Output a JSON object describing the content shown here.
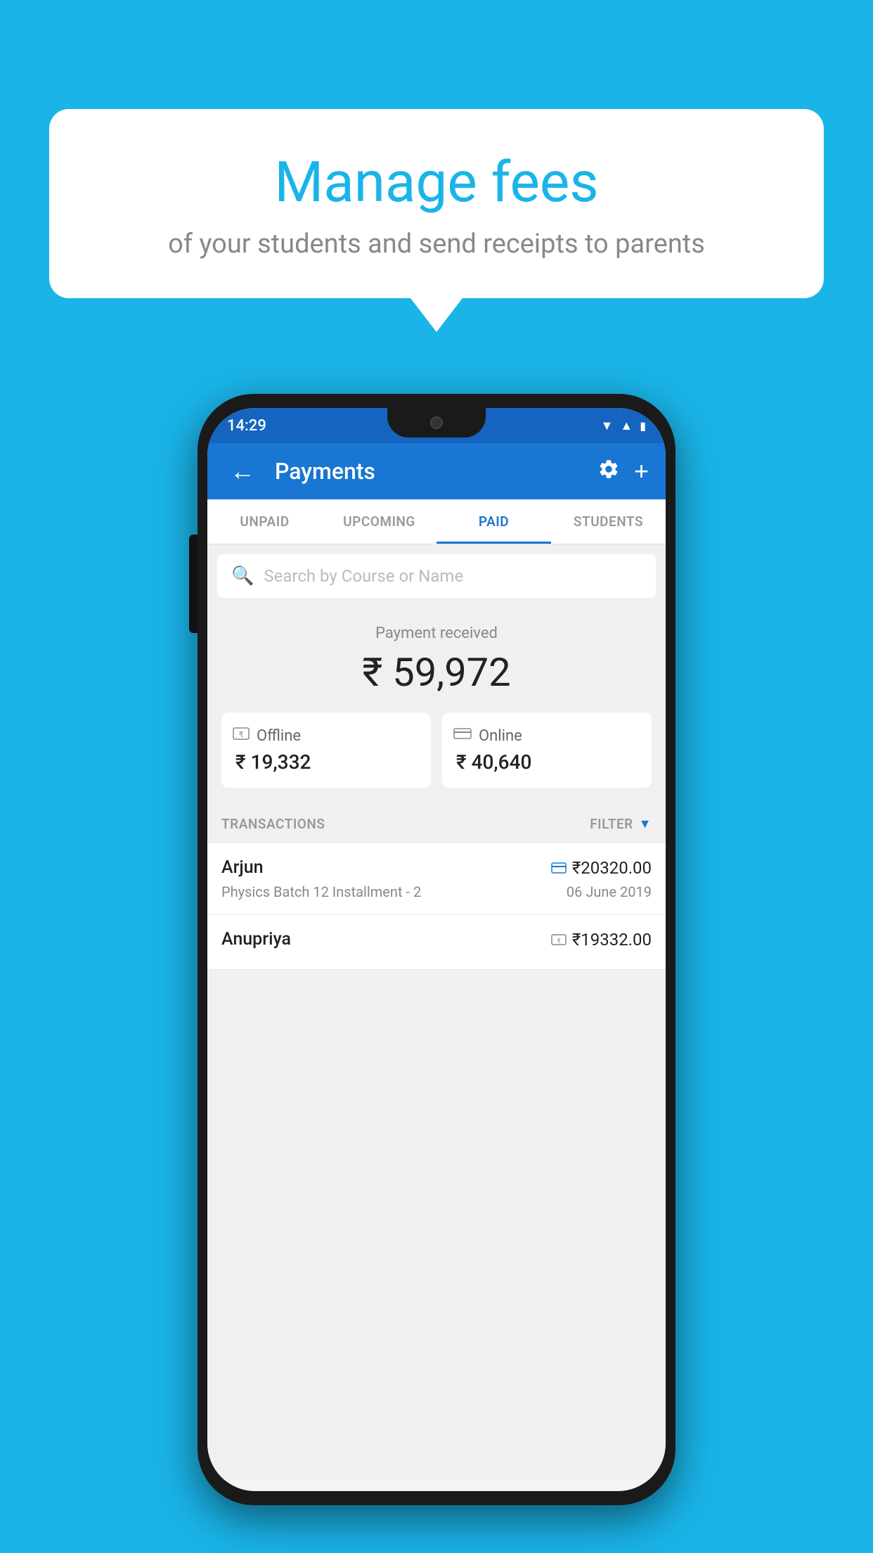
{
  "page": {
    "background_color": "#1ab4e8"
  },
  "bubble": {
    "title": "Manage fees",
    "subtitle": "of your students and send receipts to parents"
  },
  "status_bar": {
    "time": "14:29",
    "icons": [
      "wifi",
      "signal",
      "battery"
    ]
  },
  "app_bar": {
    "title": "Payments",
    "back_label": "←",
    "settings_label": "⚙",
    "add_label": "+"
  },
  "tabs": [
    {
      "label": "UNPAID",
      "active": false
    },
    {
      "label": "UPCOMING",
      "active": false
    },
    {
      "label": "PAID",
      "active": true
    },
    {
      "label": "STUDENTS",
      "active": false
    }
  ],
  "search": {
    "placeholder": "Search by Course or Name"
  },
  "payment": {
    "section_label": "Payment received",
    "total_amount": "₹ 59,972",
    "offline_label": "Offline",
    "offline_amount": "₹ 19,332",
    "online_label": "Online",
    "online_amount": "₹ 40,640"
  },
  "transactions": {
    "header_label": "TRANSACTIONS",
    "filter_label": "FILTER",
    "items": [
      {
        "name": "Arjun",
        "amount": "₹20320.00",
        "detail": "Physics Batch 12 Installment - 2",
        "date": "06 June 2019",
        "payment_type": "card"
      },
      {
        "name": "Anupriya",
        "amount": "₹19332.00",
        "detail": "",
        "date": "",
        "payment_type": "cash"
      }
    ]
  }
}
